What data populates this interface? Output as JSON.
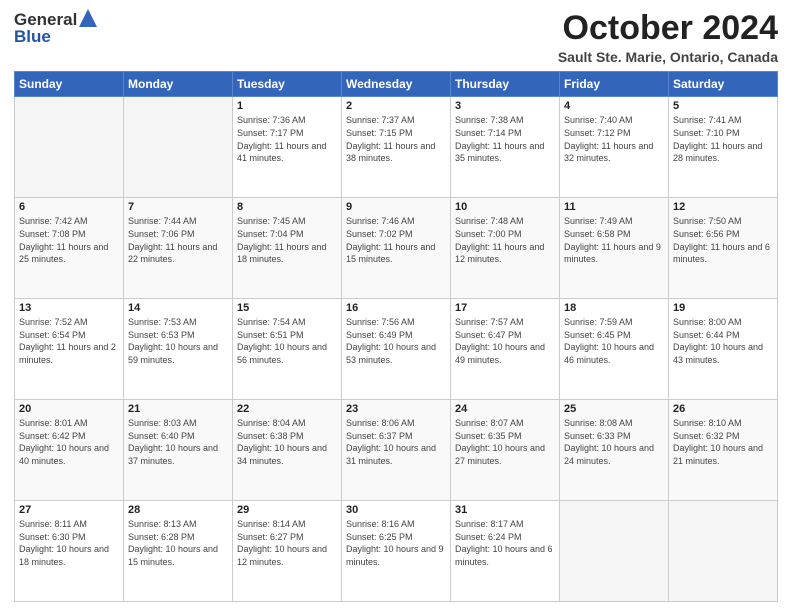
{
  "header": {
    "logo_general": "General",
    "logo_blue": "Blue",
    "month_title": "October 2024",
    "location": "Sault Ste. Marie, Ontario, Canada"
  },
  "days_of_week": [
    "Sunday",
    "Monday",
    "Tuesday",
    "Wednesday",
    "Thursday",
    "Friday",
    "Saturday"
  ],
  "weeks": [
    [
      {
        "day": "",
        "sunrise": "",
        "sunset": "",
        "daylight": ""
      },
      {
        "day": "",
        "sunrise": "",
        "sunset": "",
        "daylight": ""
      },
      {
        "day": "1",
        "sunrise": "Sunrise: 7:36 AM",
        "sunset": "Sunset: 7:17 PM",
        "daylight": "Daylight: 11 hours and 41 minutes."
      },
      {
        "day": "2",
        "sunrise": "Sunrise: 7:37 AM",
        "sunset": "Sunset: 7:15 PM",
        "daylight": "Daylight: 11 hours and 38 minutes."
      },
      {
        "day": "3",
        "sunrise": "Sunrise: 7:38 AM",
        "sunset": "Sunset: 7:14 PM",
        "daylight": "Daylight: 11 hours and 35 minutes."
      },
      {
        "day": "4",
        "sunrise": "Sunrise: 7:40 AM",
        "sunset": "Sunset: 7:12 PM",
        "daylight": "Daylight: 11 hours and 32 minutes."
      },
      {
        "day": "5",
        "sunrise": "Sunrise: 7:41 AM",
        "sunset": "Sunset: 7:10 PM",
        "daylight": "Daylight: 11 hours and 28 minutes."
      }
    ],
    [
      {
        "day": "6",
        "sunrise": "Sunrise: 7:42 AM",
        "sunset": "Sunset: 7:08 PM",
        "daylight": "Daylight: 11 hours and 25 minutes."
      },
      {
        "day": "7",
        "sunrise": "Sunrise: 7:44 AM",
        "sunset": "Sunset: 7:06 PM",
        "daylight": "Daylight: 11 hours and 22 minutes."
      },
      {
        "day": "8",
        "sunrise": "Sunrise: 7:45 AM",
        "sunset": "Sunset: 7:04 PM",
        "daylight": "Daylight: 11 hours and 18 minutes."
      },
      {
        "day": "9",
        "sunrise": "Sunrise: 7:46 AM",
        "sunset": "Sunset: 7:02 PM",
        "daylight": "Daylight: 11 hours and 15 minutes."
      },
      {
        "day": "10",
        "sunrise": "Sunrise: 7:48 AM",
        "sunset": "Sunset: 7:00 PM",
        "daylight": "Daylight: 11 hours and 12 minutes."
      },
      {
        "day": "11",
        "sunrise": "Sunrise: 7:49 AM",
        "sunset": "Sunset: 6:58 PM",
        "daylight": "Daylight: 11 hours and 9 minutes."
      },
      {
        "day": "12",
        "sunrise": "Sunrise: 7:50 AM",
        "sunset": "Sunset: 6:56 PM",
        "daylight": "Daylight: 11 hours and 6 minutes."
      }
    ],
    [
      {
        "day": "13",
        "sunrise": "Sunrise: 7:52 AM",
        "sunset": "Sunset: 6:54 PM",
        "daylight": "Daylight: 11 hours and 2 minutes."
      },
      {
        "day": "14",
        "sunrise": "Sunrise: 7:53 AM",
        "sunset": "Sunset: 6:53 PM",
        "daylight": "Daylight: 10 hours and 59 minutes."
      },
      {
        "day": "15",
        "sunrise": "Sunrise: 7:54 AM",
        "sunset": "Sunset: 6:51 PM",
        "daylight": "Daylight: 10 hours and 56 minutes."
      },
      {
        "day": "16",
        "sunrise": "Sunrise: 7:56 AM",
        "sunset": "Sunset: 6:49 PM",
        "daylight": "Daylight: 10 hours and 53 minutes."
      },
      {
        "day": "17",
        "sunrise": "Sunrise: 7:57 AM",
        "sunset": "Sunset: 6:47 PM",
        "daylight": "Daylight: 10 hours and 49 minutes."
      },
      {
        "day": "18",
        "sunrise": "Sunrise: 7:59 AM",
        "sunset": "Sunset: 6:45 PM",
        "daylight": "Daylight: 10 hours and 46 minutes."
      },
      {
        "day": "19",
        "sunrise": "Sunrise: 8:00 AM",
        "sunset": "Sunset: 6:44 PM",
        "daylight": "Daylight: 10 hours and 43 minutes."
      }
    ],
    [
      {
        "day": "20",
        "sunrise": "Sunrise: 8:01 AM",
        "sunset": "Sunset: 6:42 PM",
        "daylight": "Daylight: 10 hours and 40 minutes."
      },
      {
        "day": "21",
        "sunrise": "Sunrise: 8:03 AM",
        "sunset": "Sunset: 6:40 PM",
        "daylight": "Daylight: 10 hours and 37 minutes."
      },
      {
        "day": "22",
        "sunrise": "Sunrise: 8:04 AM",
        "sunset": "Sunset: 6:38 PM",
        "daylight": "Daylight: 10 hours and 34 minutes."
      },
      {
        "day": "23",
        "sunrise": "Sunrise: 8:06 AM",
        "sunset": "Sunset: 6:37 PM",
        "daylight": "Daylight: 10 hours and 31 minutes."
      },
      {
        "day": "24",
        "sunrise": "Sunrise: 8:07 AM",
        "sunset": "Sunset: 6:35 PM",
        "daylight": "Daylight: 10 hours and 27 minutes."
      },
      {
        "day": "25",
        "sunrise": "Sunrise: 8:08 AM",
        "sunset": "Sunset: 6:33 PM",
        "daylight": "Daylight: 10 hours and 24 minutes."
      },
      {
        "day": "26",
        "sunrise": "Sunrise: 8:10 AM",
        "sunset": "Sunset: 6:32 PM",
        "daylight": "Daylight: 10 hours and 21 minutes."
      }
    ],
    [
      {
        "day": "27",
        "sunrise": "Sunrise: 8:11 AM",
        "sunset": "Sunset: 6:30 PM",
        "daylight": "Daylight: 10 hours and 18 minutes."
      },
      {
        "day": "28",
        "sunrise": "Sunrise: 8:13 AM",
        "sunset": "Sunset: 6:28 PM",
        "daylight": "Daylight: 10 hours and 15 minutes."
      },
      {
        "day": "29",
        "sunrise": "Sunrise: 8:14 AM",
        "sunset": "Sunset: 6:27 PM",
        "daylight": "Daylight: 10 hours and 12 minutes."
      },
      {
        "day": "30",
        "sunrise": "Sunrise: 8:16 AM",
        "sunset": "Sunset: 6:25 PM",
        "daylight": "Daylight: 10 hours and 9 minutes."
      },
      {
        "day": "31",
        "sunrise": "Sunrise: 8:17 AM",
        "sunset": "Sunset: 6:24 PM",
        "daylight": "Daylight: 10 hours and 6 minutes."
      },
      {
        "day": "",
        "sunrise": "",
        "sunset": "",
        "daylight": ""
      },
      {
        "day": "",
        "sunrise": "",
        "sunset": "",
        "daylight": ""
      }
    ]
  ]
}
